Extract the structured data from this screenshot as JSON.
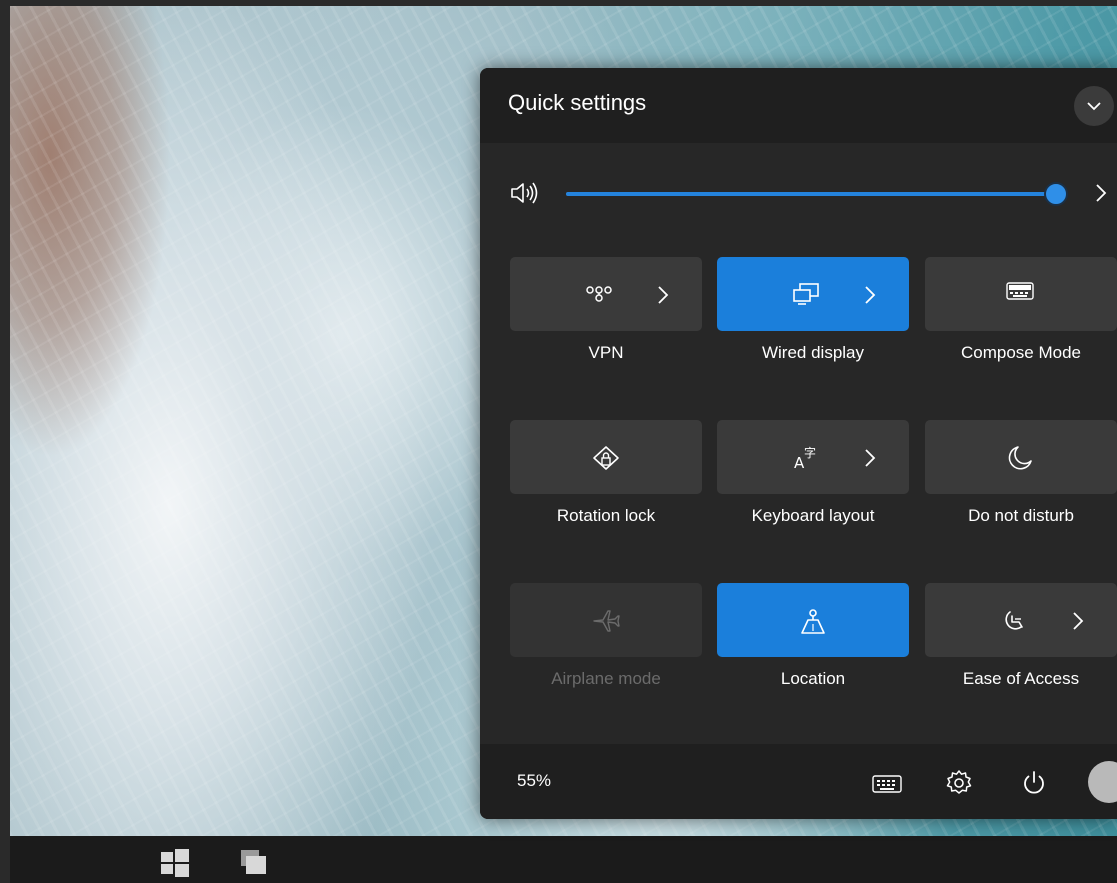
{
  "panel": {
    "title": "Quick settings",
    "collapse_icon": "chevron-down-icon"
  },
  "volume": {
    "icon": "speaker-icon",
    "level_percent": 100,
    "more_icon": "chevron-right-icon"
  },
  "tiles": [
    {
      "label": "VPN",
      "icon": "vpn-icon",
      "state": "off",
      "has_more": true
    },
    {
      "label": "Wired display",
      "icon": "wired-display-icon",
      "state": "on",
      "has_more": true
    },
    {
      "label": "Compose Mode",
      "icon": "keyboard-icon",
      "state": "off",
      "has_more": false
    },
    {
      "label": "Rotation lock",
      "icon": "rotation-lock-icon",
      "state": "off",
      "has_more": false
    },
    {
      "label": "Keyboard layout",
      "icon": "keyboard-layout-icon",
      "state": "off",
      "has_more": true
    },
    {
      "label": "Do not disturb",
      "icon": "moon-icon",
      "state": "off",
      "has_more": false
    },
    {
      "label": "Airplane mode",
      "icon": "airplane-icon",
      "state": "disabled",
      "has_more": false
    },
    {
      "label": "Location",
      "icon": "location-icon",
      "state": "on",
      "has_more": false
    },
    {
      "label": "Ease of Access",
      "icon": "accessibility-icon",
      "state": "off",
      "has_more": true
    }
  ],
  "footer": {
    "battery": "55%",
    "icons": [
      "keyboard-icon",
      "gear-icon",
      "power-icon",
      "avatar"
    ]
  },
  "taskbar": {
    "icons": [
      "windows-icon",
      "task-view-icon"
    ]
  },
  "colors": {
    "accent": "#1b7fdb",
    "panel_bg": "#272727",
    "header_bg": "#1f1f1f",
    "tile_off": "#3a3a3a",
    "taskbar_bg": "#1b1b1b"
  }
}
